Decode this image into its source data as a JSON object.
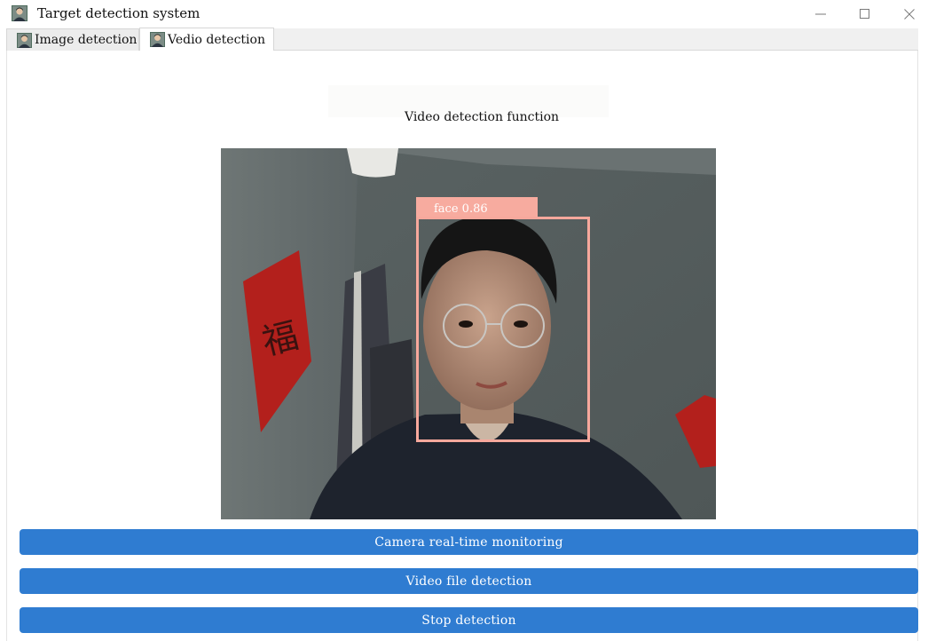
{
  "window": {
    "title": "Target detection system",
    "icon": "portrait-app-icon",
    "controls": {
      "minimize": "minimize-icon",
      "maximize": "maximize-icon",
      "close": "close-icon"
    }
  },
  "tabs": [
    {
      "label": "Image detection",
      "icon": "portrait-icon",
      "active": false
    },
    {
      "label": "Vedio detection",
      "icon": "portrait-icon",
      "active": true
    }
  ],
  "main": {
    "heading": "Video detection function",
    "detection": {
      "label": "face 0.86",
      "box_color": "#f7a89c"
    }
  },
  "buttons": {
    "camera": "Camera real-time monitoring",
    "file": "Video file detection",
    "stop": "Stop detection"
  },
  "colors": {
    "accent": "#2f7cd1",
    "detection": "#f7a89c"
  }
}
